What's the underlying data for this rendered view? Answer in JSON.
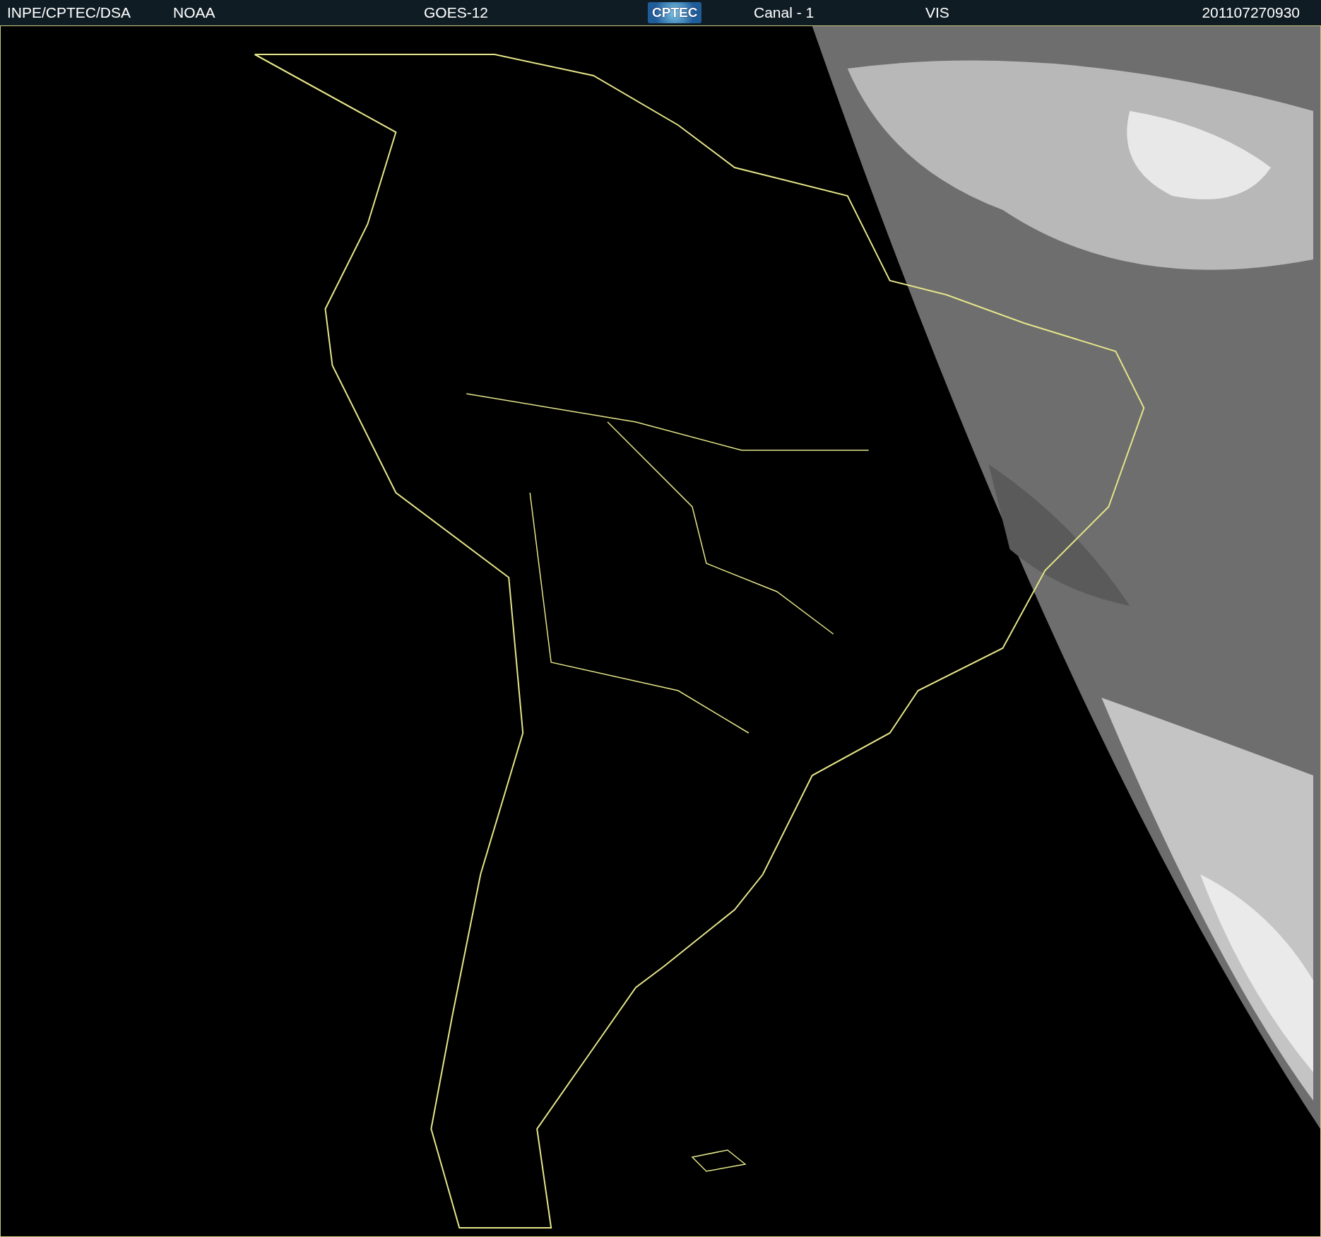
{
  "header": {
    "items": [
      {
        "kind": "text",
        "text": "INPE/CPTEC/DSA"
      },
      {
        "kind": "text",
        "text": "NOAA"
      },
      {
        "kind": "text",
        "text": "GOES-12"
      },
      {
        "kind": "logo",
        "text": "CPTEC"
      },
      {
        "kind": "text",
        "text": "Canal - 1"
      },
      {
        "kind": "text",
        "text": "VIS"
      },
      {
        "kind": "text",
        "text": "201107270930"
      }
    ]
  }
}
